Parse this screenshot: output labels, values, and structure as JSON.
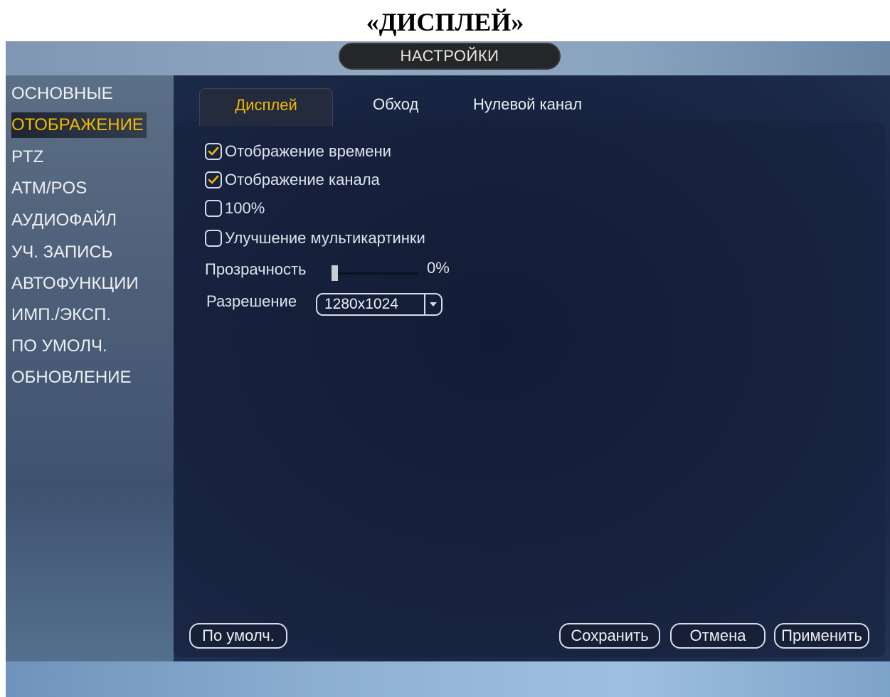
{
  "doc_heading": "«ДИСПЛЕЙ»",
  "window": {
    "title": "НАСТРОЙКИ"
  },
  "sidebar": {
    "items": [
      {
        "label": "ОСНОВНЫЕ",
        "active": false
      },
      {
        "label": "ОТОБРАЖЕНИЕ",
        "active": true
      },
      {
        "label": "PTZ",
        "active": false
      },
      {
        "label": "ATM/POS",
        "active": false
      },
      {
        "label": "АУДИОФАЙЛ",
        "active": false
      },
      {
        "label": "УЧ. ЗАПИСЬ",
        "active": false
      },
      {
        "label": "АВТОФУНКЦИИ",
        "active": false
      },
      {
        "label": "ИМП./ЭКСП.",
        "active": false
      },
      {
        "label": "ПО УМОЛЧ.",
        "active": false
      },
      {
        "label": "ОБНОВЛЕНИЕ",
        "active": false
      }
    ]
  },
  "tabs": [
    {
      "label": "Дисплей",
      "active": true
    },
    {
      "label": "Обход",
      "active": false
    },
    {
      "label": "Нулевой канал",
      "active": false
    }
  ],
  "options": {
    "time_display": {
      "label": "Отображение времени",
      "checked": true
    },
    "channel_display": {
      "label": "Отображение канала",
      "checked": true
    },
    "full_scale": {
      "label": "100%",
      "checked": false
    },
    "multi_enhance": {
      "label": "Улучшение мультикартинки",
      "checked": false
    }
  },
  "transparency": {
    "label": "Прозрачность",
    "value_text": "0%",
    "value": 0
  },
  "resolution": {
    "label": "Разрешение",
    "value": "1280x1024"
  },
  "buttons": {
    "default": "По умолч.",
    "save": "Сохранить",
    "cancel": "Отмена",
    "apply": "Применить"
  },
  "colors": {
    "accent": "#f6b800",
    "checkbox_check": "#f6b800",
    "text": "#dfe3ea"
  },
  "icons": {
    "checkbox": "checkmark-icon",
    "dropdown": "chevron-down-icon"
  }
}
